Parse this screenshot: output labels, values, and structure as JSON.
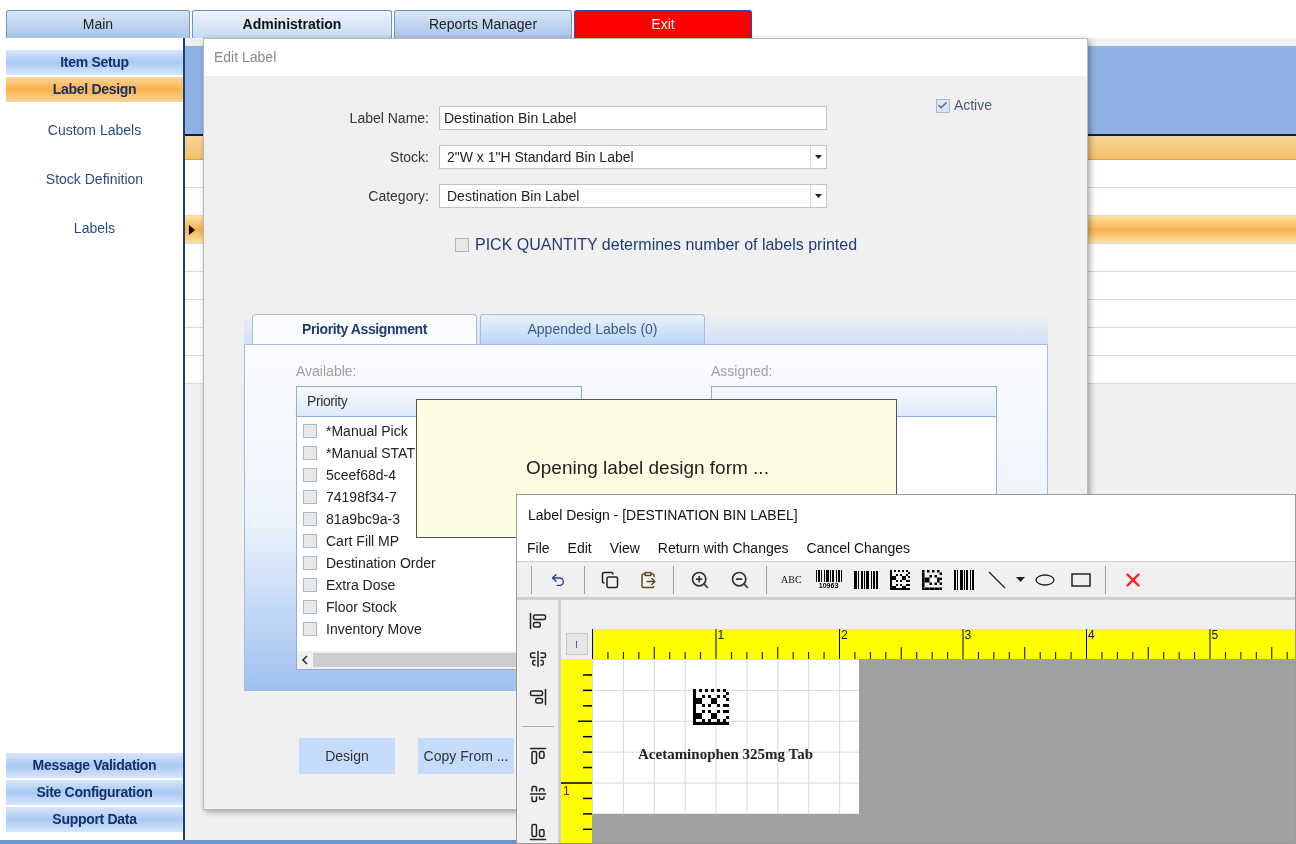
{
  "top_tabs": [
    {
      "label": "Main",
      "selected": false,
      "kind": "normal"
    },
    {
      "label": "Administration",
      "selected": true,
      "kind": "normal"
    },
    {
      "label": "Reports Manager",
      "selected": false,
      "kind": "normal"
    },
    {
      "label": "Exit",
      "selected": false,
      "kind": "exit"
    }
  ],
  "sidebar": {
    "sections": [
      {
        "label": "Item Setup",
        "selected": false
      },
      {
        "label": "Label Design",
        "selected": true
      }
    ],
    "items": [
      {
        "label": "Custom Labels"
      },
      {
        "label": "Stock Definition"
      },
      {
        "label": "Labels"
      }
    ],
    "bottom_sections": [
      {
        "label": "Message Validation",
        "selected": false
      },
      {
        "label": "Site Configuration",
        "selected": false
      },
      {
        "label": "Support Data",
        "selected": false
      }
    ]
  },
  "grid": {
    "rows": [
      {
        "selected": false
      },
      {
        "selected": false
      },
      {
        "selected": true
      },
      {
        "selected": false
      },
      {
        "selected": false
      },
      {
        "selected": false
      },
      {
        "selected": false
      },
      {
        "selected": false
      }
    ]
  },
  "edit_label": {
    "title": "Edit Label",
    "active": {
      "label": "Active",
      "checked": true
    },
    "fields": [
      {
        "label": "Label Name:",
        "value": "Destination Bin Label",
        "kind": "text"
      },
      {
        "label": "Stock:",
        "value": "2\"W x 1\"H Standard Bin Label",
        "kind": "dropdown"
      },
      {
        "label": "Category:",
        "value": "Destination Bin Label",
        "kind": "dropdown"
      }
    ],
    "pick_quantity": {
      "label": "PICK QUANTITY determines number of labels printed",
      "checked": false
    },
    "tabs": [
      {
        "label": "Priority Assignment",
        "selected": true
      },
      {
        "label": "Appended Labels (0)",
        "selected": false
      }
    ],
    "available": {
      "label": "Available:",
      "column": "Priority",
      "items": [
        {
          "label": "*Manual Pick",
          "checked": false
        },
        {
          "label": "*Manual STAT",
          "checked": false
        },
        {
          "label": "5ceef68d-4",
          "checked": false
        },
        {
          "label": "74198f34-7",
          "checked": false
        },
        {
          "label": "81a9bc9a-3",
          "checked": false
        },
        {
          "label": "Cart Fill MP",
          "checked": false
        },
        {
          "label": "Destination Order",
          "checked": false
        },
        {
          "label": "Extra Dose",
          "checked": false
        },
        {
          "label": "Floor Stock",
          "checked": false
        },
        {
          "label": "Inventory Move",
          "checked": false
        }
      ]
    },
    "assigned": {
      "label": "Assigned:"
    },
    "buttons": [
      "Design",
      "Copy From ..."
    ]
  },
  "tooltip": {
    "text": "Opening label design form ..."
  },
  "label_design": {
    "title": "Label Design - [DESTINATION BIN LABEL]",
    "menu": [
      "File",
      "Edit",
      "View",
      "Return with Changes",
      "Cancel Changes"
    ],
    "toolbar": [
      {
        "kind": "separator"
      },
      {
        "kind": "undo"
      },
      {
        "kind": "separator"
      },
      {
        "kind": "copy"
      },
      {
        "kind": "paste"
      },
      {
        "kind": "separator"
      },
      {
        "kind": "zoom-in"
      },
      {
        "kind": "zoom-out"
      },
      {
        "kind": "separator"
      },
      {
        "kind": "text",
        "label": "ABC"
      },
      {
        "kind": "barcode",
        "caption": "10963"
      },
      {
        "kind": "barcode-2d"
      },
      {
        "kind": "qr"
      },
      {
        "kind": "datamatrix"
      },
      {
        "kind": "barcode-vertical"
      },
      {
        "kind": "line"
      },
      {
        "kind": "dropdown"
      },
      {
        "kind": "ellipse"
      },
      {
        "kind": "rectangle"
      },
      {
        "kind": "separator"
      },
      {
        "kind": "delete"
      }
    ],
    "side_toolbar": [
      {
        "kind": "align-left"
      },
      {
        "kind": "align-center"
      },
      {
        "kind": "align-right"
      },
      {
        "kind": "separator"
      },
      {
        "kind": "align-top"
      },
      {
        "kind": "align-middle"
      },
      {
        "kind": "align-bottom"
      }
    ],
    "ruler": {
      "h_marks": [
        "1",
        "2",
        "3",
        "4",
        "5"
      ],
      "v_marks": [
        "1"
      ]
    },
    "label": {
      "text": "Acetaminophen 325mg Tab"
    }
  }
}
